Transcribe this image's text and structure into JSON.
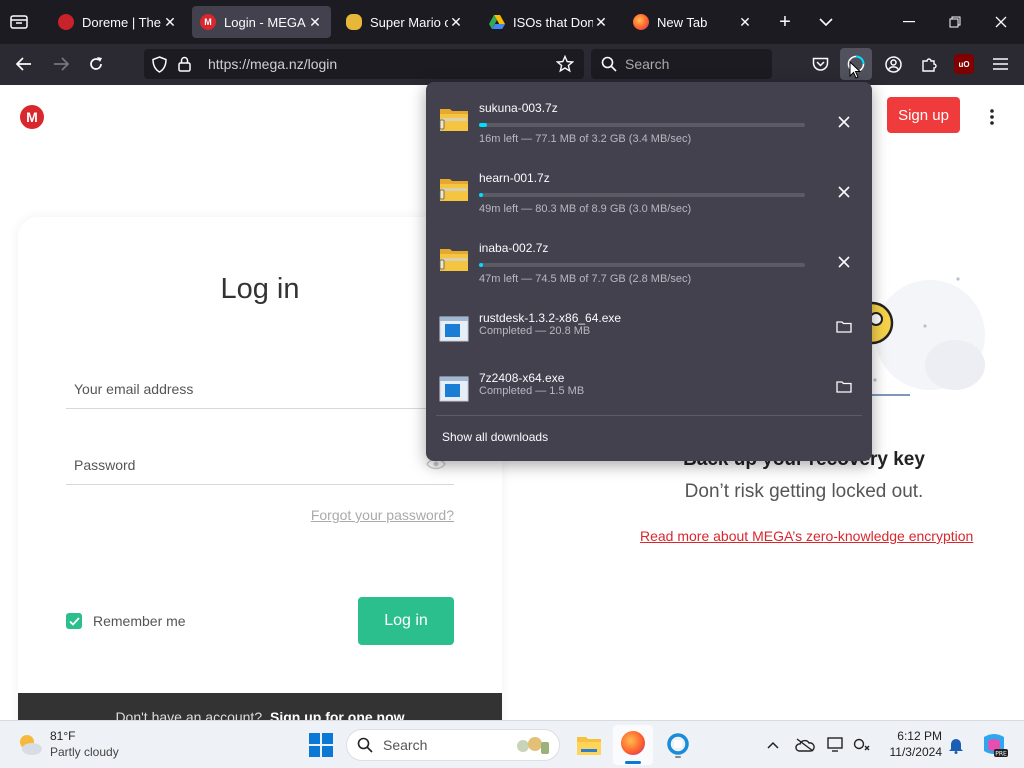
{
  "browser": {
    "tabs": [
      {
        "title": "Doreme | The La",
        "icon": "doreme-favicon",
        "active": false
      },
      {
        "title": "Login - MEGA",
        "icon": "mega-favicon",
        "active": true
      },
      {
        "title": "Super Mario on",
        "icon": "coin-favicon",
        "active": false
      },
      {
        "title": "ISOs that Don't",
        "icon": "google-drive-favicon",
        "active": false
      },
      {
        "title": "New Tab",
        "icon": "firefox-favicon",
        "active": false
      }
    ],
    "url": "https://mega.nz/login",
    "search_placeholder": "Search"
  },
  "page": {
    "logo_letter": "M",
    "signup_label": "Sign up",
    "login_title": "Log in",
    "email_placeholder": "Your email address",
    "password_placeholder": "Password",
    "forgot_link": "Forgot your password?",
    "remember_label": "Remember me",
    "login_button": "Log in",
    "footer_text": "Don't have an account?",
    "footer_link": "Sign up for one now",
    "recovery_title": "Back up your recovery key",
    "recovery_subtitle": "Don’t risk getting locked out.",
    "encryption_link": "Read more about MEGA’s zero-knowledge encryption"
  },
  "downloads": {
    "items": [
      {
        "name": "sukuna-003.7z",
        "status": "16m left — 77.1 MB of 3.2 GB (3.4 MB/sec)",
        "progress": 0.024,
        "state": "in-progress",
        "icon": "archive-file-icon"
      },
      {
        "name": "hearn-001.7z",
        "status": "49m left — 80.3 MB of 8.9 GB (3.0 MB/sec)",
        "progress": 0.009,
        "state": "in-progress",
        "icon": "archive-file-icon"
      },
      {
        "name": "inaba-002.7z",
        "status": "47m left — 74.5 MB of 7.7 GB (2.8 MB/sec)",
        "progress": 0.0097,
        "state": "in-progress",
        "icon": "archive-file-icon"
      },
      {
        "name": "rustdesk-1.3.2-x86_64.exe",
        "status": "Completed — 20.8 MB",
        "progress": 1,
        "state": "completed",
        "icon": "exe-file-icon"
      },
      {
        "name": "7z2408-x64.exe",
        "status": "Completed — 1.5 MB",
        "progress": 1,
        "state": "completed",
        "icon": "exe-file-icon"
      }
    ],
    "show_all": "Show all downloads"
  },
  "taskbar": {
    "weather_temp": "81°F",
    "weather_desc": "Partly cloudy",
    "search_label": "Search",
    "time": "6:12 PM",
    "date": "11/3/2024"
  },
  "colors": {
    "mega_red": "#d9272e",
    "login_green": "#2bbf8e",
    "download_progress": "#00ddff",
    "firefox_dark": "#1c1b22"
  }
}
